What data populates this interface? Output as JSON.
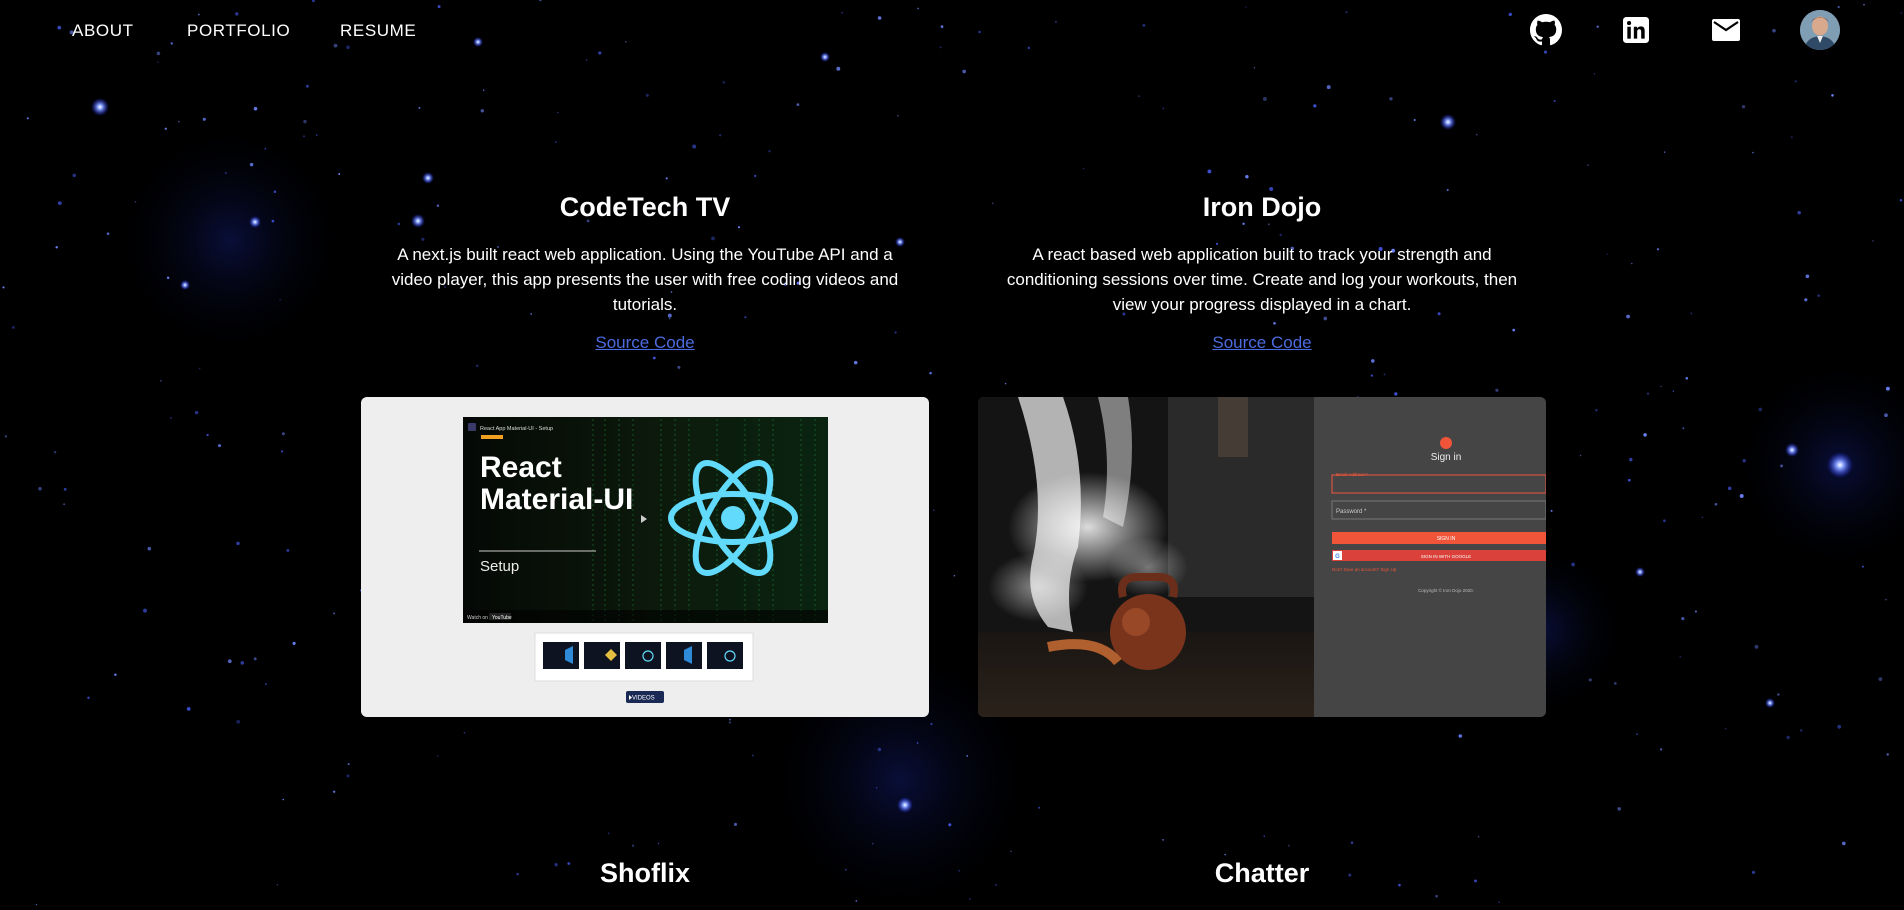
{
  "nav": {
    "links": [
      "ABOUT",
      "PORTFOLIO",
      "RESUME"
    ],
    "icons": [
      "github-icon",
      "linkedin-icon",
      "mail-icon"
    ]
  },
  "projects": [
    {
      "title": "CodeTech TV",
      "description": "A next.js built react web application. Using the YouTube API and a video player, this app presents the user with free coding videos and tutorials.",
      "link": "Source Code",
      "screenshot": {
        "video_title": "React App Material-UI - Setup",
        "headline_1": "React",
        "headline_2": "Material-UI",
        "subhead": "Setup",
        "watch_on": "Watch on",
        "youtube": "YouTube",
        "button": "VIDEOS"
      }
    },
    {
      "title": "Iron Dojo",
      "description": "A react based web application built to track your strength and conditioning sessions over time. Create and log your workouts, then view your progress displayed in a chart.",
      "link": "Source Code",
      "screenshot": {
        "signin": "Sign in",
        "email_label": "Email Address *",
        "password_label": "Password *",
        "signin_button": "SIGN IN",
        "google_button": "SIGN IN WITH GOOGLE",
        "signup_text": "Don't have an account? Sign Up",
        "copyright": "Copyright © Iron Dojo 2020."
      }
    },
    {
      "title": "Shoflix"
    },
    {
      "title": "Chatter"
    }
  ],
  "colors": {
    "background": "#000000",
    "link": "#4c6be0",
    "react_blue": "#61dafb",
    "dojo_red": "#f0553a"
  }
}
